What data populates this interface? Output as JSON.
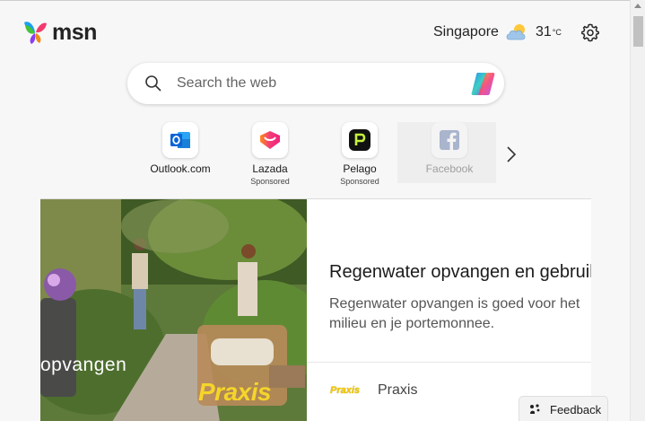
{
  "header": {
    "logo_text": "msn",
    "weather": {
      "city": "Singapore",
      "temperature": "31",
      "unit": "°C",
      "icon": "partly-cloudy-icon"
    },
    "settings_icon": "gear-icon"
  },
  "search": {
    "placeholder": "Search the web",
    "value": "",
    "copilot_icon": "copilot-icon"
  },
  "quick_links": [
    {
      "label": "Outlook.com",
      "sponsored": "",
      "icon": "outlook-icon"
    },
    {
      "label": "Lazada",
      "sponsored": "Sponsored",
      "icon": "lazada-icon"
    },
    {
      "label": "Pelago",
      "sponsored": "Sponsored",
      "icon": "pelago-icon"
    },
    {
      "label": "Facebook",
      "sponsored": "",
      "icon": "facebook-icon"
    }
  ],
  "feature_card": {
    "image_overlay_text": "opvangen",
    "image_brand_text": "Praxis",
    "title": "Regenwater opvangen en gebruiken",
    "description": "Regenwater opvangen is goed voor het milieu en je portemonnee.",
    "source_logo": "Praxis",
    "source_name": "Praxis"
  },
  "feedback": {
    "label": "Feedback"
  },
  "colors": {
    "background": "#f7f7f7",
    "praxis_yellow": "#f6d52a",
    "outlook_blue": "#0a64d6"
  }
}
